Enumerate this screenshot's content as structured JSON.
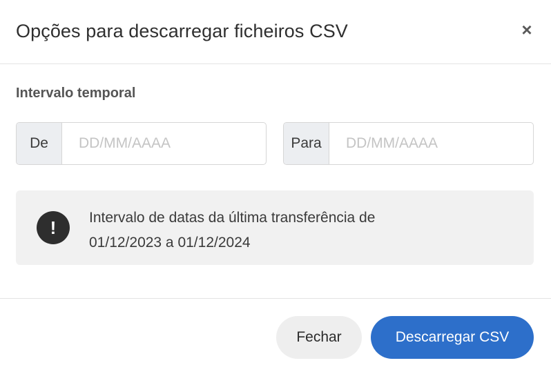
{
  "dialog": {
    "title": "Opções para descarregar ficheiros CSV",
    "close_glyph": "×",
    "close_icon": "close-icon"
  },
  "interval": {
    "label": "Intervalo temporal",
    "from": {
      "addon": "De",
      "value": "",
      "placeholder": "DD/MM/AAAA"
    },
    "to": {
      "addon": "Para",
      "value": "",
      "placeholder": "DD/MM/AAAA"
    }
  },
  "notice": {
    "icon": "exclamation-icon",
    "icon_glyph": "!",
    "line1": "Intervalo de datas da última transferência de",
    "line2": "01/12/2023 a 01/12/2024"
  },
  "footer": {
    "close_label": "Fechar",
    "download_label": "Descarregar CSV"
  },
  "colors": {
    "primary": "#2d6fca",
    "notice_bg": "#f1f1f1",
    "addon_bg": "#eceef1"
  }
}
